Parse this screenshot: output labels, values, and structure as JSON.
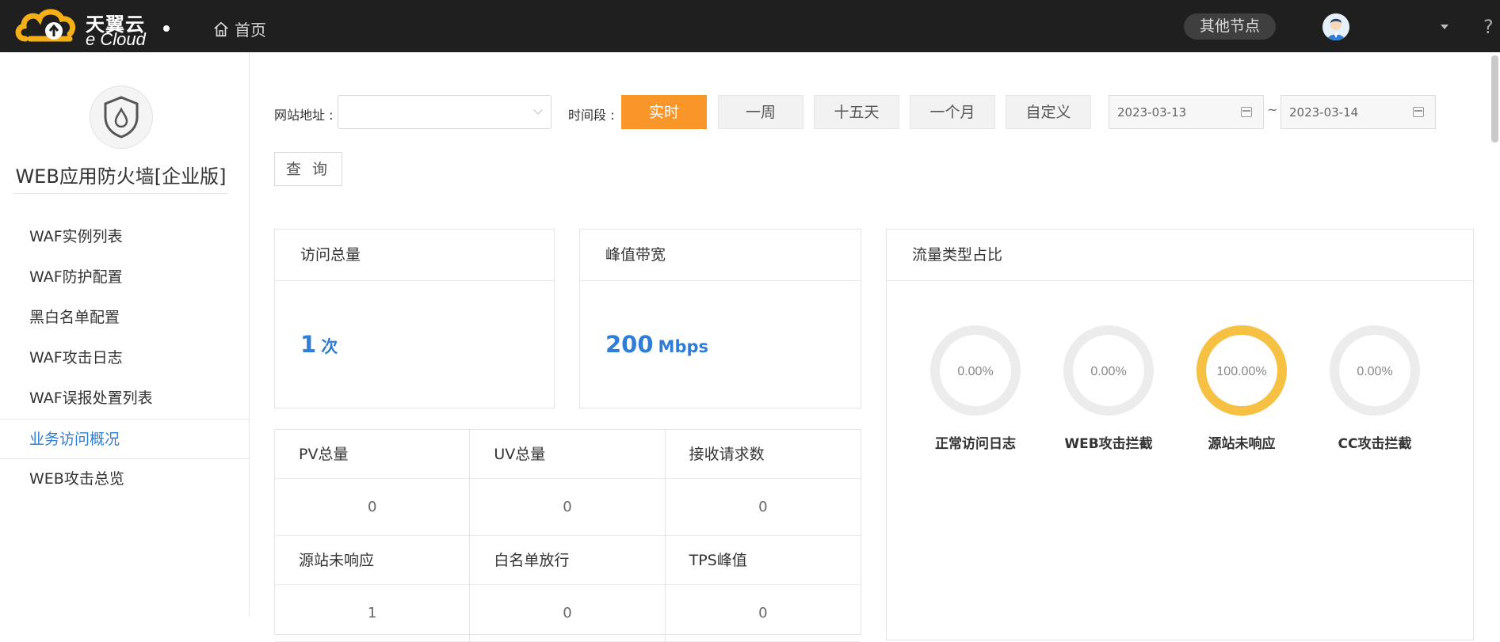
{
  "header": {
    "logo_cn": "天翼云",
    "logo_en": "e Cloud",
    "home_label": "首页",
    "other_nodes_label": "其他节点",
    "help_label": "?"
  },
  "sidebar": {
    "product_title": "WEB应用防火墙[企业版]",
    "items": [
      {
        "label": "WAF实例列表"
      },
      {
        "label": "WAF防护配置"
      },
      {
        "label": "黑白名单配置"
      },
      {
        "label": "WAF攻击日志"
      },
      {
        "label": "WAF误报处置列表"
      },
      {
        "label": "业务访问概况",
        "active": true
      },
      {
        "label": "WEB攻击总览"
      }
    ]
  },
  "filter": {
    "site_label": "网站地址 :",
    "site_value": "",
    "period_label": "时间段 :",
    "periods": [
      "实时",
      "一周",
      "十五天",
      "一个月",
      "自定义"
    ],
    "selected_period": "实时",
    "date_start": "2023-03-13",
    "date_sep": "~",
    "date_end": "2023-03-14",
    "query_label": "查 询"
  },
  "stats": {
    "visits": {
      "title": "访问总量",
      "value": "1",
      "unit": "次"
    },
    "bandwidth": {
      "title": "峰值带宽",
      "value": "200",
      "unit": "Mbps"
    },
    "grid": [
      [
        {
          "title": "PV总量",
          "value": "0"
        },
        {
          "title": "UV总量",
          "value": "0"
        },
        {
          "title": "接收请求数",
          "value": "0"
        }
      ],
      [
        {
          "title": "源站未响应",
          "value": "1"
        },
        {
          "title": "白名单放行",
          "value": "0"
        },
        {
          "title": "TPS峰值",
          "value": "0"
        }
      ]
    ]
  },
  "traffic": {
    "title": "流量类型占比",
    "items": [
      {
        "label": "正常访问日志",
        "percent_text": "0.00%",
        "percent": 0
      },
      {
        "label": "WEB攻击拦截",
        "percent_text": "0.00%",
        "percent": 0
      },
      {
        "label": "源站未响应",
        "percent_text": "100.00%",
        "percent": 100
      },
      {
        "label": "CC攻击拦截",
        "percent_text": "0.00%",
        "percent": 0
      }
    ]
  },
  "colors": {
    "accent_orange": "#f8962a",
    "link_blue": "#2f7dd6",
    "donut_fill": "#f6c142",
    "donut_track": "#ececec",
    "topbar": "#1f1f1f"
  }
}
